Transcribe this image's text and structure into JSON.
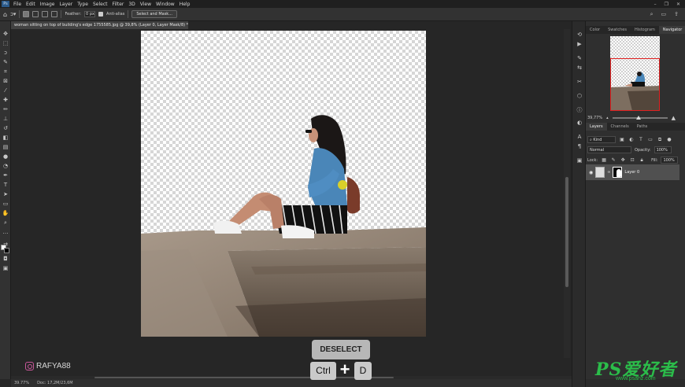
{
  "menubar": {
    "items": [
      "File",
      "Edit",
      "Image",
      "Layer",
      "Type",
      "Select",
      "Filter",
      "3D",
      "View",
      "Window",
      "Help"
    ],
    "window_controls": [
      "–",
      "❐",
      "✕"
    ]
  },
  "options": {
    "feather_label": "Feather:",
    "feather_value": "0 px",
    "antialias_label": "Anti-alias",
    "select_mask_label": "Select and Mask..."
  },
  "document": {
    "tab_title": "woman sitting on top of building's edge 1755585.jpg @ 39,8% (Layer 0, Layer Mask/8) *"
  },
  "status": {
    "zoom": "39.77%",
    "doc": "Doc: 17,2M/23,6M"
  },
  "panels": {
    "top_tabs": [
      "Color",
      "Swatches",
      "Histogram",
      "Navigator"
    ],
    "active_top_tab": "Navigator",
    "nav_zoom": "39,77%",
    "layer_tabs": [
      "Layers",
      "Channels",
      "Paths"
    ],
    "active_layer_tab": "Layers",
    "filter_kind": "Kind",
    "blend_mode": "Normal",
    "opacity_label": "Opacity:",
    "opacity_value": "100%",
    "lock_label": "Lock:",
    "fill_label": "Fill:",
    "fill_value": "100%",
    "layer_name": "Layer 0"
  },
  "overlay": {
    "deselect": "DESELECT",
    "key_ctrl": "Ctrl",
    "key_plus": "+",
    "key_d": "D",
    "handle": "RAFYA88"
  },
  "watermark": {
    "main": "PS爱好者",
    "url": "www.psahz.com"
  },
  "colors": {
    "mask_frame": "#e02020",
    "watermark": "#2bbd4a",
    "jacket": "#4a86b8"
  }
}
